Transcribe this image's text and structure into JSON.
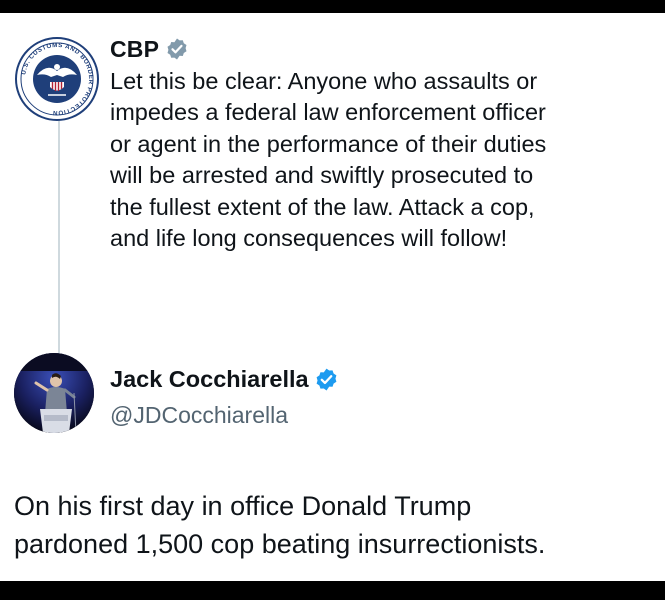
{
  "quoted_tweet": {
    "author_name": "CBP",
    "verified_badge": "gray-verified-badge-icon",
    "avatar": "cbp-seal",
    "seal_text": "U.S. CUSTOMS AND BORDER PROTECTION",
    "text_lines": [
      "Let this be clear: Anyone who assaults or",
      "impedes a federal law enforcement officer",
      "or agent in the performance of their duties",
      "will be arrested and swiftly prosecuted to",
      "the fullest extent of the law. Attack a cop,",
      "and life long consequences will follow!"
    ]
  },
  "reply_tweet": {
    "author_name": "Jack Cocchiarella",
    "handle": "@JDCocchiarella",
    "verified_badge": "blue-verified-badge-icon",
    "avatar": "speaker-at-podium-photo",
    "text_lines": [
      "On his first day in office Donald Trump",
      "pardoned 1,500 cop beating insurrectionists."
    ]
  },
  "colors": {
    "text_primary": "#0f1419",
    "text_secondary": "#536471",
    "verified_blue": "#1d9bf0",
    "verified_gray": "#829aab",
    "thread_line": "#cfd9de",
    "cbp_seal_blue": "#1f3f7a"
  }
}
